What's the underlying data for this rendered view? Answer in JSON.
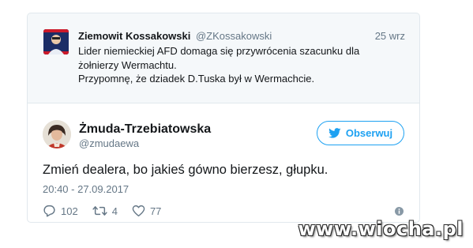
{
  "quoted_tweet": {
    "author_name": "Ziemowit Kossakowski",
    "author_handle": "@ZKossakowski",
    "date": "25 wrz",
    "text_line_1": "Lider niemieckiej AFD domaga się przywrócenia szacunku dla",
    "text_line_2": "żołnierzy Wermachtu.",
    "text_line_3": "Przypomnę, że dziadek D.Tuska był w Wermachcie.",
    "avatar_icon": "avatar-photo"
  },
  "tweet": {
    "author_name": "Żmuda-Trzebiatowska",
    "author_handle": "@zmudaewa",
    "follow_label": "Obserwuj",
    "text": "Zmień dealera, bo jakieś gówno bierzesz, głupku.",
    "timestamp": "20:40 - 27.09.2017",
    "replies": "102",
    "retweets": "4",
    "likes": "77",
    "avatar_icon": "avatar-photo"
  },
  "icons": {
    "reply": "reply-icon",
    "retweet": "retweet-icon",
    "like": "heart-icon",
    "info": "info-icon",
    "twitter": "twitter-bird-icon"
  },
  "colors": {
    "accent": "#1da1f2",
    "secondary_text": "#657786",
    "border": "#e1e8ed",
    "quoted_bg": "#f5f8fa"
  },
  "watermark": "www.wiocha.pl"
}
